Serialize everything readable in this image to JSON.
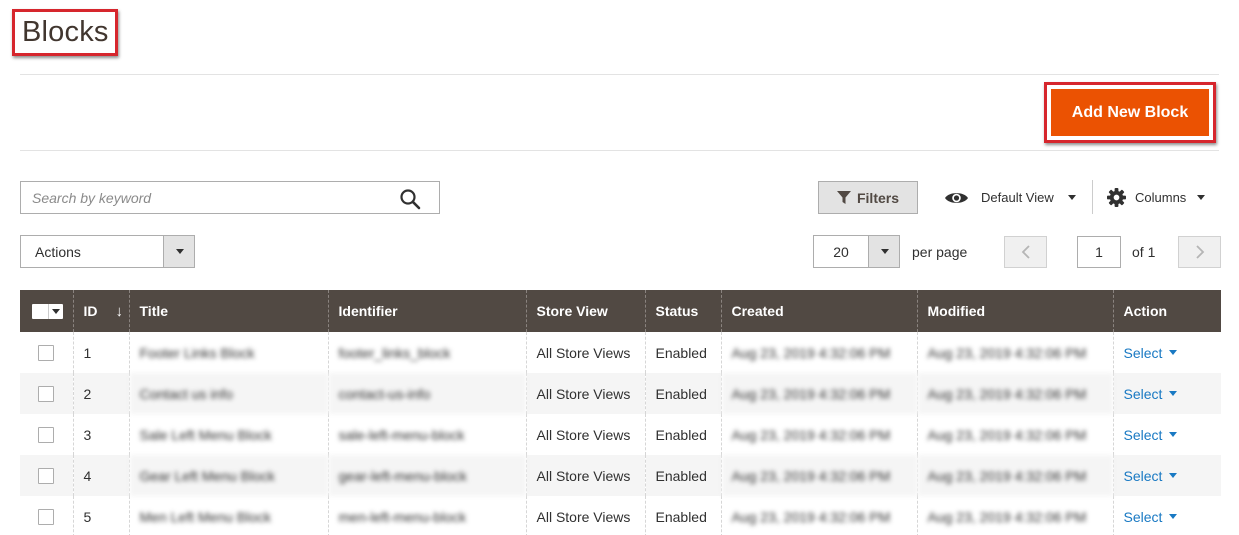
{
  "header": {
    "title": "Blocks"
  },
  "toolbar": {
    "add_label": "Add New Block"
  },
  "search": {
    "placeholder": "Search by keyword",
    "value": ""
  },
  "controls": {
    "filters_label": "Filters",
    "view_label": "Default View",
    "columns_label": "Columns",
    "actions_label": "Actions",
    "per_page_value": "20",
    "per_page_label": "per page",
    "page_value": "1",
    "page_of": "of 1"
  },
  "icons": {
    "search": "search-icon",
    "filter": "filter-icon",
    "view": "eye-icon",
    "columns": "gear-icon",
    "prev": "chevron-left-icon",
    "next": "chevron-right-icon"
  },
  "colors": {
    "accent": "#eb5202",
    "header_bg": "#514943",
    "link": "#1979c3",
    "highlight": "#d6262d"
  },
  "table": {
    "columns": [
      "ID",
      "Title",
      "Identifier",
      "Store View",
      "Status",
      "Created",
      "Modified",
      "Action"
    ],
    "sort_indicator": "↓",
    "rows": [
      {
        "id": "1",
        "title": "Footer Links Block",
        "identifier": "footer_links_block",
        "store_view": "All Store Views",
        "status": "Enabled",
        "created": "Aug 23, 2019 4:32:06 PM",
        "modified": "Aug 23, 2019 4:32:06 PM",
        "action": "Select"
      },
      {
        "id": "2",
        "title": "Contact us info",
        "identifier": "contact-us-info",
        "store_view": "All Store Views",
        "status": "Enabled",
        "created": "Aug 23, 2019 4:32:06 PM",
        "modified": "Aug 23, 2019 4:32:06 PM",
        "action": "Select"
      },
      {
        "id": "3",
        "title": "Sale Left Menu Block",
        "identifier": "sale-left-menu-block",
        "store_view": "All Store Views",
        "status": "Enabled",
        "created": "Aug 23, 2019 4:32:06 PM",
        "modified": "Aug 23, 2019 4:32:06 PM",
        "action": "Select"
      },
      {
        "id": "4",
        "title": "Gear Left Menu Block",
        "identifier": "gear-left-menu-block",
        "store_view": "All Store Views",
        "status": "Enabled",
        "created": "Aug 23, 2019 4:32:06 PM",
        "modified": "Aug 23, 2019 4:32:06 PM",
        "action": "Select"
      },
      {
        "id": "5",
        "title": "Men Left Menu Block",
        "identifier": "men-left-menu-block",
        "store_view": "All Store Views",
        "status": "Enabled",
        "created": "Aug 23, 2019 4:32:06 PM",
        "modified": "Aug 23, 2019 4:32:06 PM",
        "action": "Select"
      }
    ]
  }
}
